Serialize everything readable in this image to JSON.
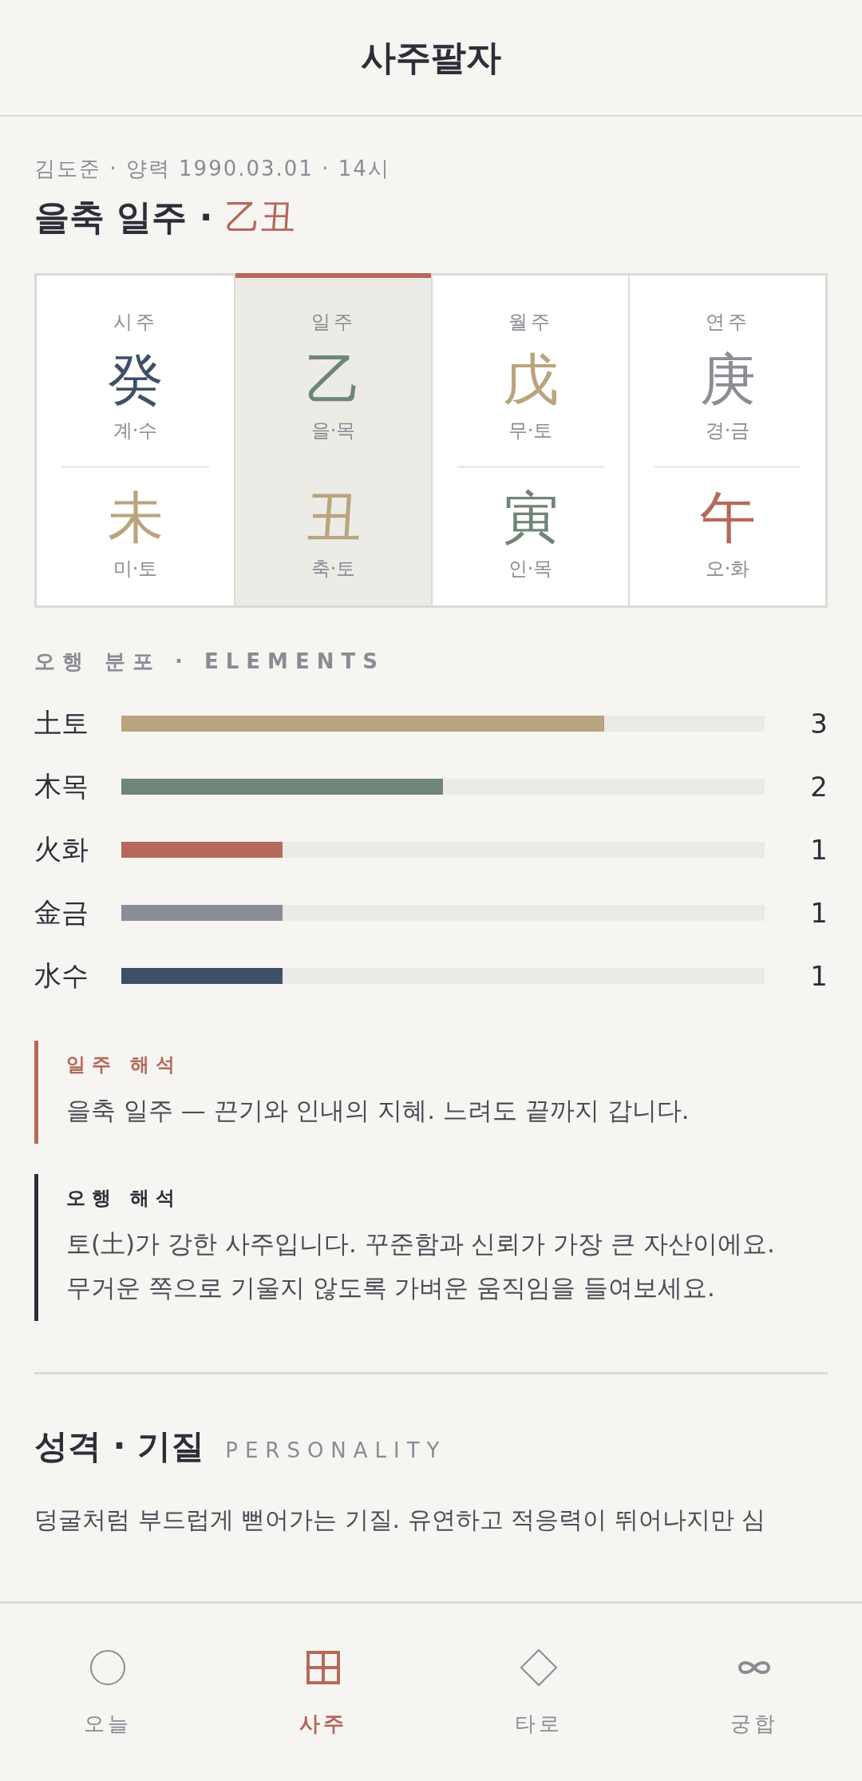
{
  "header": {
    "title": "사주팔자"
  },
  "profile": {
    "subtitle": "김도준 · 양력 1990.03.01 · 14시",
    "heading": "을축 일주 · ",
    "heading_hanja": "乙丑"
  },
  "pillars": [
    {
      "label": "시주",
      "selected": false,
      "stem": {
        "char": "癸",
        "reading": "계·수",
        "color": "#3d5068"
      },
      "branch": {
        "char": "未",
        "reading": "미·토",
        "color": "#b8a47e"
      }
    },
    {
      "label": "일주",
      "selected": true,
      "stem": {
        "char": "乙",
        "reading": "을·목",
        "color": "#6e8676"
      },
      "branch": {
        "char": "丑",
        "reading": "축·토",
        "color": "#b8a47e"
      }
    },
    {
      "label": "월주",
      "selected": false,
      "stem": {
        "char": "戊",
        "reading": "무·토",
        "color": "#b8a47e"
      },
      "branch": {
        "char": "寅",
        "reading": "인·목",
        "color": "#6e8676"
      }
    },
    {
      "label": "연주",
      "selected": false,
      "stem": {
        "char": "庚",
        "reading": "경·금",
        "color": "#8b8d96"
      },
      "branch": {
        "char": "午",
        "reading": "오·화",
        "color": "#b5695a"
      }
    }
  ],
  "elements_title": "오행 분포 · ELEMENTS",
  "elements": [
    {
      "name": "土토",
      "level": 0.75,
      "count": "3",
      "color": "#b8a47e"
    },
    {
      "name": "木목",
      "level": 0.5,
      "count": "2",
      "color": "#6e8676"
    },
    {
      "name": "火화",
      "level": 0.25,
      "count": "1",
      "color": "#b5695a"
    },
    {
      "name": "金금",
      "level": 0.25,
      "count": "1",
      "color": "#8b8d96"
    },
    {
      "name": "水수",
      "level": 0.25,
      "count": "1",
      "color": "#3d5068"
    }
  ],
  "notes": [
    {
      "title": "일주 해석",
      "text": "을축 일주 — 끈기와 인내의 지혜. 느려도 끝까지 갑니다.",
      "color": "#b5695a"
    },
    {
      "title": "오행 해석",
      "text": "토(土)가 강한 사주입니다. 꾸준함과 신뢰가 가장 큰 자산이에요.\n무거운 쪽으로 기울지 않도록 가벼운 움직임을 들여보세요.",
      "color": "#2c2f38"
    }
  ],
  "personality": {
    "title": "성격 · 기질",
    "subtitle": "PERSONALITY",
    "text": "덩굴처럼 부드럽게 뻗어가는 기질. 유연하고 적응력이 뛰어나지만 심"
  },
  "nav": [
    {
      "label": "오늘",
      "kind": "circle",
      "selected": false
    },
    {
      "label": "사주",
      "kind": "grid",
      "selected": true
    },
    {
      "label": "타로",
      "kind": "diamond",
      "selected": false
    },
    {
      "label": "궁합",
      "kind": "infinity",
      "selected": false
    }
  ]
}
